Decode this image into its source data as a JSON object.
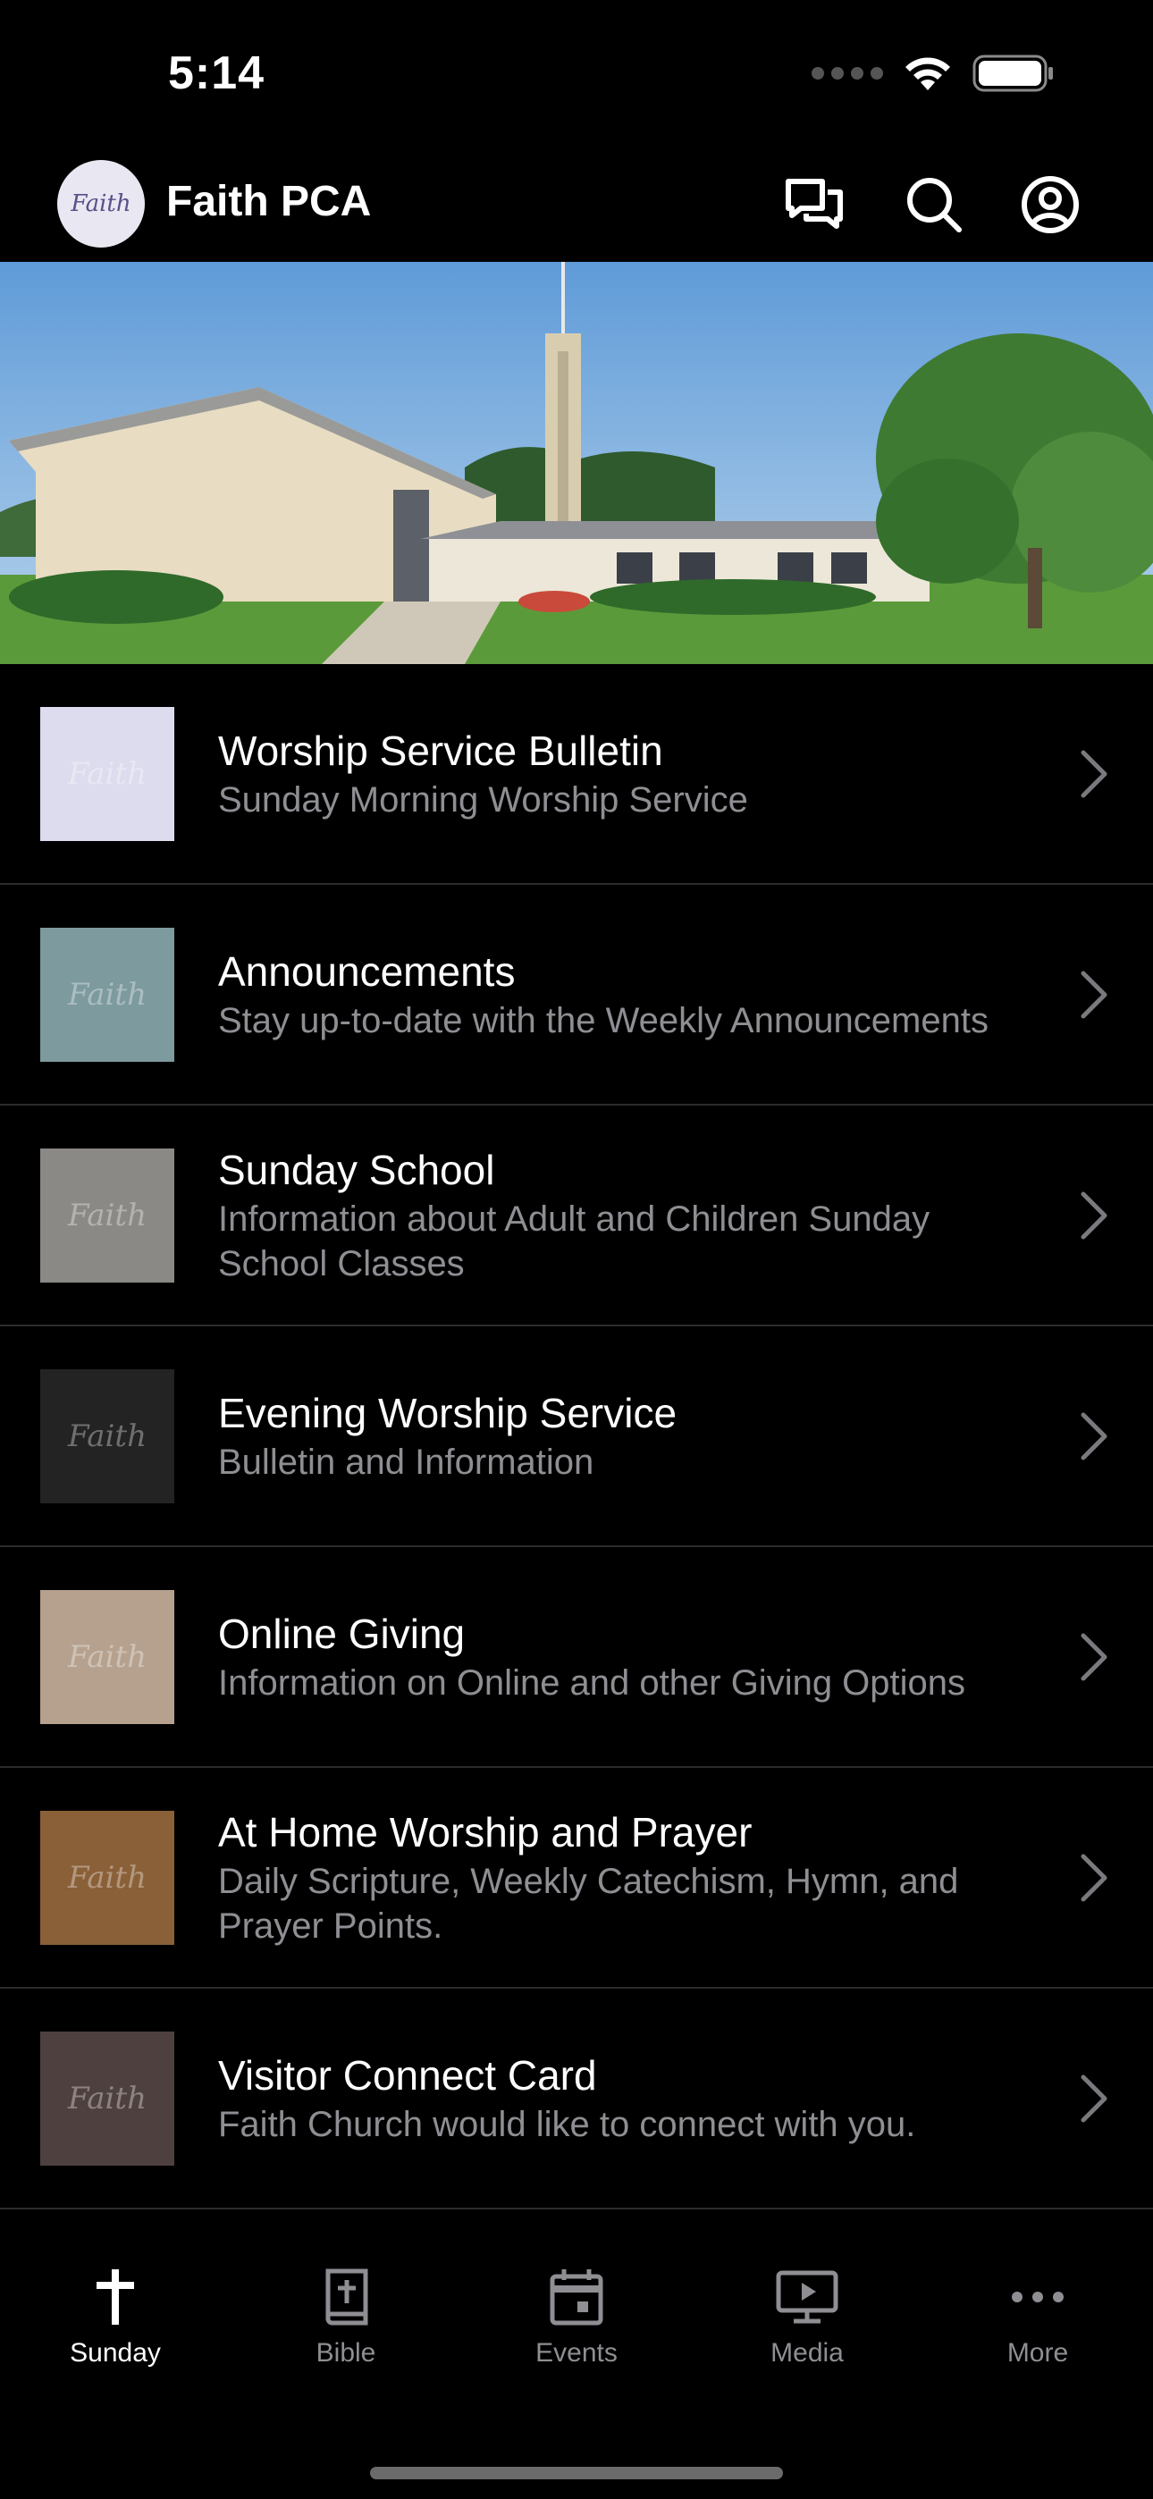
{
  "status_bar": {
    "time": "5:14"
  },
  "header": {
    "title": "Faith PCA",
    "avatar_text": "Faith",
    "icons": [
      "chat-icon",
      "search-icon",
      "account-icon"
    ]
  },
  "hero": {
    "description_icon": "church-photo"
  },
  "list": [
    {
      "title": "Worship Service Bulletin",
      "subtitle": "Sunday Morning Worship Service",
      "thumb_color": "#dcdcee",
      "thumb_text": "Faith"
    },
    {
      "title": "Announcements",
      "subtitle": "Stay up-to-date with the Weekly Announcements",
      "thumb_color": "#7d9a9e",
      "thumb_text": "Faith"
    },
    {
      "title": "Sunday School",
      "subtitle": "Information about Adult and Children Sunday School Classes",
      "thumb_color": "#8b8985",
      "thumb_text": "Faith"
    },
    {
      "title": "Evening Worship Service",
      "subtitle": "Bulletin and Information",
      "thumb_color": "#232323",
      "thumb_text": "Faith"
    },
    {
      "title": "Online Giving",
      "subtitle": "Information on Online and other Giving Options",
      "thumb_color": "#b5a18e",
      "thumb_text": "Faith"
    },
    {
      "title": "At Home Worship and Prayer",
      "subtitle": "Daily Scripture, Weekly Catechism, Hymn, and Prayer Points.",
      "thumb_color": "#8a6039",
      "thumb_text": "Faith"
    },
    {
      "title": "Visitor Connect Card",
      "subtitle": "Faith Church would like to connect with you.",
      "thumb_color": "#4f4040",
      "thumb_text": "Faith"
    }
  ],
  "tabs": [
    {
      "label": "Sunday",
      "icon": "cross-icon",
      "active": true
    },
    {
      "label": "Bible",
      "icon": "bible-icon",
      "active": false
    },
    {
      "label": "Events",
      "icon": "calendar-icon",
      "active": false
    },
    {
      "label": "Media",
      "icon": "media-icon",
      "active": false
    },
    {
      "label": "More",
      "icon": "more-icon",
      "active": false
    }
  ],
  "colors": {
    "background": "#000000",
    "separator": "#2c2c2e",
    "subtitle": "#8e8e93",
    "inactive_tab": "#8e8e93"
  }
}
